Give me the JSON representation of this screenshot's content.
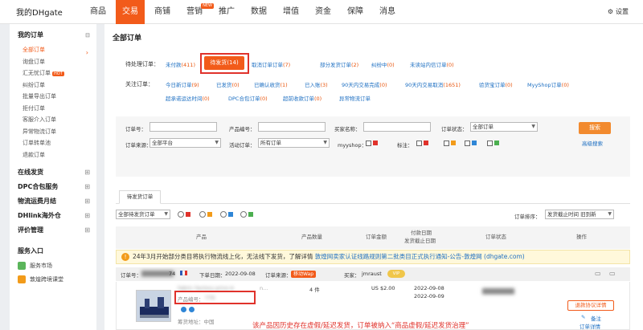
{
  "topnav": {
    "brand": "我的DHgate",
    "items": [
      "商品",
      "交易",
      "商铺",
      "营销",
      "推广",
      "数据",
      "增值",
      "资金",
      "保障",
      "消息"
    ],
    "new_tag": "NEW",
    "settings": "设置"
  },
  "sidebar": {
    "my_orders": "我的订单",
    "items": [
      "全部订单",
      "询盘订单",
      "汇无忧订单",
      "纠纷订单",
      "批量导出订单",
      "拒付订单",
      "客服介入订单",
      "异常物流订单",
      "订单转单池",
      "退款订单"
    ],
    "hot": "HOT",
    "groups": [
      "在线发货",
      "DPC合包服务",
      "物流运费月结",
      "DHlink海外仓",
      "评价管理"
    ],
    "service_title": "服务入口",
    "services": [
      "服务市场",
      "敦煌跨境课堂"
    ]
  },
  "main": {
    "title": "全部订单",
    "pending_label": "待处理订单：",
    "pending_links": [
      {
        "text": "未付款",
        "count": "(411)"
      },
      {
        "text": "待发货",
        "count": "(14)"
      },
      {
        "text": "取消订单订单",
        "count": "(7)"
      },
      {
        "text": "部分发货订单",
        "count": "(2)"
      },
      {
        "text": "纠纷中",
        "count": "(0)"
      },
      {
        "text": "未读站内信订单",
        "count": "(0)"
      }
    ],
    "focus_label": "关注订单：",
    "focus_links": [
      {
        "text": "今日新订单",
        "count": "(9)"
      },
      {
        "text": "已发货",
        "count": "(0)"
      },
      {
        "text": "已确认收货",
        "count": "(1)"
      },
      {
        "text": "已入账",
        "count": "(3)"
      },
      {
        "text": "90天内交易完成",
        "count": "(0)"
      },
      {
        "text": "90天内交易取消",
        "count": "(1651)"
      },
      {
        "text": "验货宝订单",
        "count": "(0)"
      },
      {
        "text": "MyyShop订单",
        "count": "(0)"
      },
      {
        "text": "超承诺运达时间",
        "count": "(0)"
      },
      {
        "text": "DPC合包订单",
        "count": "(0)"
      },
      {
        "text": "超前收款订单",
        "count": "(0)"
      },
      {
        "text": "异常物流订单",
        "count": ""
      }
    ]
  },
  "search": {
    "order_no": "订单号：",
    "product_no": "产品编号：",
    "buyer_name": "买家名称：",
    "order_status": "订单状态：",
    "order_status_value": "全部订单",
    "order_source": "订单来源：",
    "order_source_value": "全部平台",
    "activity": "活动订单：",
    "activity_value": "所有订单",
    "myyshop": "myyshop：",
    "mark": "标注：",
    "search_btn": "搜索",
    "advanced": "高级搜索"
  },
  "tabs": {
    "pending_ship": "待发货订单"
  },
  "filter": {
    "all_pending": "全部待发货订单",
    "sort_label": "订单排序：",
    "sort_value": "发货截止时间 旧到新"
  },
  "table": {
    "headers": [
      "产品",
      "产品数量",
      "订单金额",
      "付款日期",
      "发货截止日期",
      "订单状态",
      "操作"
    ]
  },
  "notice": {
    "text": "24年3月开始部分类目将执行物流线上化，无法线下发货，了解详情",
    "link": "敦煌网卖家认证线路规则第二批类目正式执行通知-公告-敦煌网 (dhgate.com)"
  },
  "order": {
    "order_no_label": "订单号：",
    "order_no_value": "74",
    "date_label": "下单日期：",
    "date_value": "2022-09-08",
    "source_label": "订单来源：",
    "source_value": "移动Wap",
    "buyer_label": "买家：",
    "buyer_value": "jmraust",
    "vip": "VIP",
    "product_name": "Fabric Factory price A",
    "product_code_label": "产品编号：",
    "product_code_value": "776",
    "shipped_from": "筹货地址：中国",
    "quantity": "4 件",
    "amount": "US $2.00",
    "pay_date": "2022-09-08",
    "ship_deadline": "2022-09-09",
    "refund_btn": "退款协议详情",
    "remark": "备注",
    "detail": "订单详情"
  },
  "caption": "该产品因历史存在虚假/延迟发货，订单被纳入“商品虚假/延迟发货治理”",
  "colors": {
    "accent": "#f25b1a",
    "link": "#1d6fc2",
    "alert": "#e0322b"
  }
}
